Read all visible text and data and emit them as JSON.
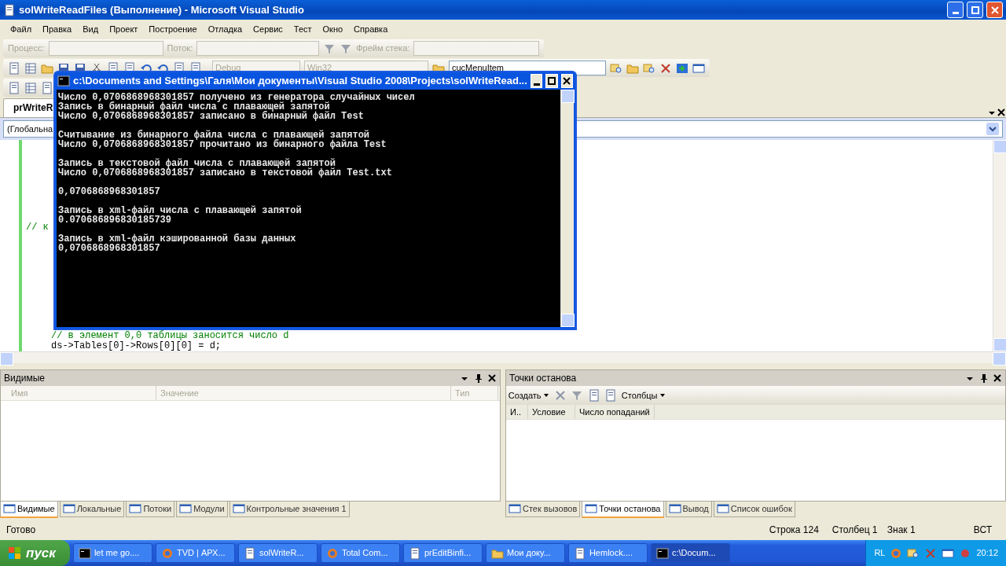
{
  "window": {
    "title": "solWriteReadFiles (Выполнение) - Microsoft Visual Studio"
  },
  "menu": [
    "Файл",
    "Правка",
    "Вид",
    "Проект",
    "Построение",
    "Отладка",
    "Сервис",
    "Тест",
    "Окно",
    "Справка"
  ],
  "debug_toolbar": {
    "process_label": "Процесс:",
    "thread_label": "Поток:",
    "stack_frame_label": "Фрейм стека:"
  },
  "standard_toolbar": {
    "configuration": "Debug",
    "platform": "Win32",
    "find": "cucMenuItem"
  },
  "document_tabs": [
    {
      "label": "prWriteR",
      "selected": true
    }
  ],
  "scope_dropdown": "(Глобальна",
  "code_lines": [
    {
      "kind": "comment",
      "text": "// к"
    },
    {
      "kind": "comment",
      "text": "// в элемент 0,0 таблицы заносится число d"
    },
    {
      "kind": "code",
      "text": "ds->Tables[0]->Rows[0][0] = d;"
    }
  ],
  "console": {
    "title": "c:\\Documents and Settings\\Галя\\Мои документы\\Visual Studio 2008\\Projects\\solWriteRead...",
    "blocks": [
      [
        "Число 0,0706868968301857 получено из генератора случайных чисел",
        "Запись в бинарный файл числа с плавающей запятой",
        "Число 0,0706868968301857 записано в бинарный файл Test"
      ],
      [
        "Считывание из бинарного файла числа с плавающей запятой",
        "Число 0,0706868968301857 прочитано из бинарного файла Test"
      ],
      [
        "Запись в текстовой файл числа с плавающей запятой",
        "Число 0,0706868968301857 записано в текстовой файл Test.txt"
      ],
      [
        "0,0706868968301857"
      ],
      [
        "Запись в xml-файл числа с плавающей запятой",
        "0.070686896830185739"
      ],
      [
        "Запись в xml-файл кэшированной базы данных",
        "0,0706868968301857"
      ]
    ]
  },
  "watch_panel": {
    "title": "Видимые",
    "columns": [
      "Имя",
      "Значение",
      "Тип"
    ]
  },
  "breakpoints_panel": {
    "title": "Точки останова",
    "new_button": "Создать",
    "columns_button": "Столбцы",
    "columns": [
      "И..",
      "Условие",
      "Число попаданий"
    ]
  },
  "left_tabs": [
    {
      "label": "Видимые",
      "selected": true
    },
    {
      "label": "Локальные",
      "selected": false
    },
    {
      "label": "Потоки",
      "selected": false
    },
    {
      "label": "Модули",
      "selected": false
    },
    {
      "label": "Контрольные значения 1",
      "selected": false
    }
  ],
  "right_tabs": [
    {
      "label": "Стек вызовов",
      "selected": false
    },
    {
      "label": "Точки останова",
      "selected": true
    },
    {
      "label": "Вывод",
      "selected": false
    },
    {
      "label": "Список ошибок",
      "selected": false
    }
  ],
  "status_bar": {
    "message": "Готово",
    "line": "Строка 124",
    "column": "Столбец 1",
    "char": "Знак 1",
    "mode": "ВСТ"
  },
  "taskbar": {
    "start": "пуск",
    "items": [
      {
        "label": "let me go....",
        "selected": false
      },
      {
        "label": "TVD | АРХ...",
        "selected": false
      },
      {
        "label": "solWriteR...",
        "selected": false
      },
      {
        "label": "Total Com...",
        "selected": false
      },
      {
        "label": "prEditBinfi...",
        "selected": false
      },
      {
        "label": "Мои доку...",
        "selected": false
      },
      {
        "label": "Hemlock....",
        "selected": false
      },
      {
        "label": "c:\\Docum...",
        "selected": true
      }
    ],
    "language": "RL",
    "clock": "20:12"
  }
}
